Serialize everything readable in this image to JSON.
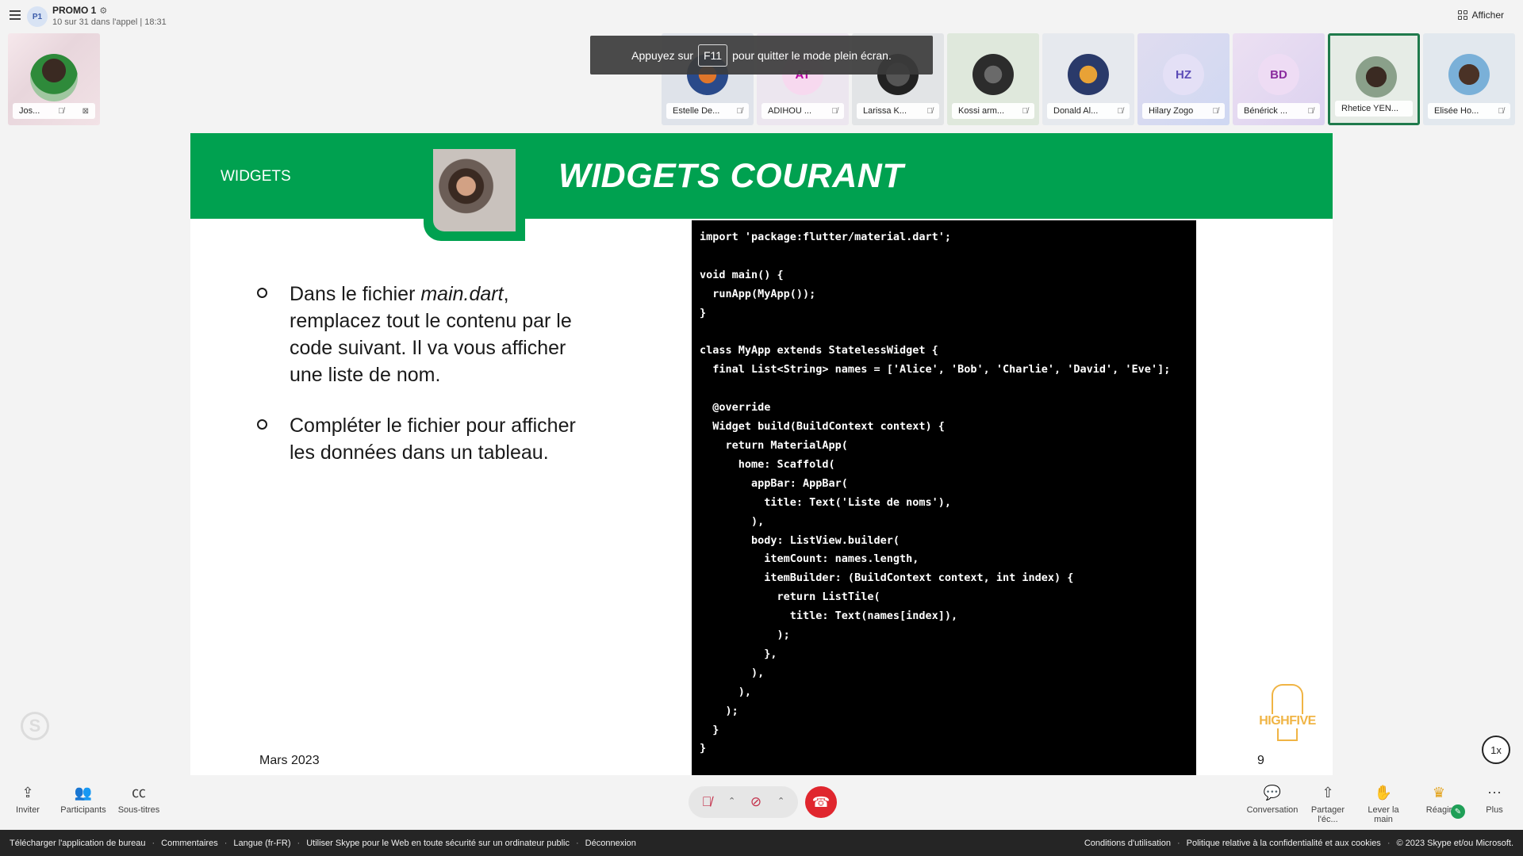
{
  "header": {
    "group_initials": "P1",
    "group_name": "PROMO 1",
    "subtitle": "10 sur 31 dans l'appel | 18:31",
    "view_label": "Afficher"
  },
  "self_tile": {
    "name": "Jos..."
  },
  "participants": [
    {
      "name": "Estelle De...",
      "initials": ""
    },
    {
      "name": "ADIHOU ...",
      "initials": "AT"
    },
    {
      "name": "Larissa K...",
      "initials": ""
    },
    {
      "name": "Kossi arm...",
      "initials": ""
    },
    {
      "name": "Donald Al...",
      "initials": ""
    },
    {
      "name": "Hilary Zogo",
      "initials": "HZ"
    },
    {
      "name": "Bénérick ...",
      "initials": "BD"
    },
    {
      "name": "Rhetice YEN...",
      "initials": ""
    },
    {
      "name": "Elisée Ho...",
      "initials": ""
    }
  ],
  "toast": {
    "before": "Appuyez sur",
    "key": "F11",
    "after": "pour quitter le mode plein écran."
  },
  "slide": {
    "section": "WIDGETS",
    "title": "WIDGETS COURANT",
    "bullet1_prefix": "Dans le fichier ",
    "bullet1_file": "main.dart",
    "bullet1_rest": ", remplacez tout le contenu par le code suivant. Il va vous afficher une liste de nom.",
    "bullet2": "Compléter le fichier pour afficher les données dans un tableau.",
    "date": "Mars 2023",
    "page": "9",
    "logo_text": "HIGHFIVE",
    "code": "import 'package:flutter/material.dart';\n\nvoid main() {\n  runApp(MyApp());\n}\n\nclass MyApp extends StatelessWidget {\n  final List<String> names = ['Alice', 'Bob', 'Charlie', 'David', 'Eve'];\n\n  @override\n  Widget build(BuildContext context) {\n    return MaterialApp(\n      home: Scaffold(\n        appBar: AppBar(\n          title: Text('Liste de noms'),\n        ),\n        body: ListView.builder(\n          itemCount: names.length,\n          itemBuilder: (BuildContext context, int index) {\n            return ListTile(\n              title: Text(names[index]),\n            );\n          },\n        ),\n      ),\n    );\n  }\n}"
  },
  "speed": "1x",
  "controls": {
    "invite": "Inviter",
    "participants": "Participants",
    "captions": "Sous-titres",
    "chat": "Conversation",
    "share": "Partager l'éc...",
    "raise_hand": "Lever la main",
    "react": "Réagir",
    "more": "Plus"
  },
  "status_bar": {
    "left": [
      "Télécharger l'application de bureau",
      "Commentaires",
      "Langue (fr-FR)",
      "Utiliser Skype pour le Web en toute sécurité sur un ordinateur public",
      "Déconnexion"
    ],
    "right": [
      "Conditions d'utilisation",
      "Politique relative à la confidentialité et aux cookies",
      "© 2023 Skype et/ou Microsoft."
    ]
  },
  "colors": {
    "slide_green": "#00a150",
    "hangup_red": "#e0262e",
    "logo_gold": "#f0b444"
  }
}
